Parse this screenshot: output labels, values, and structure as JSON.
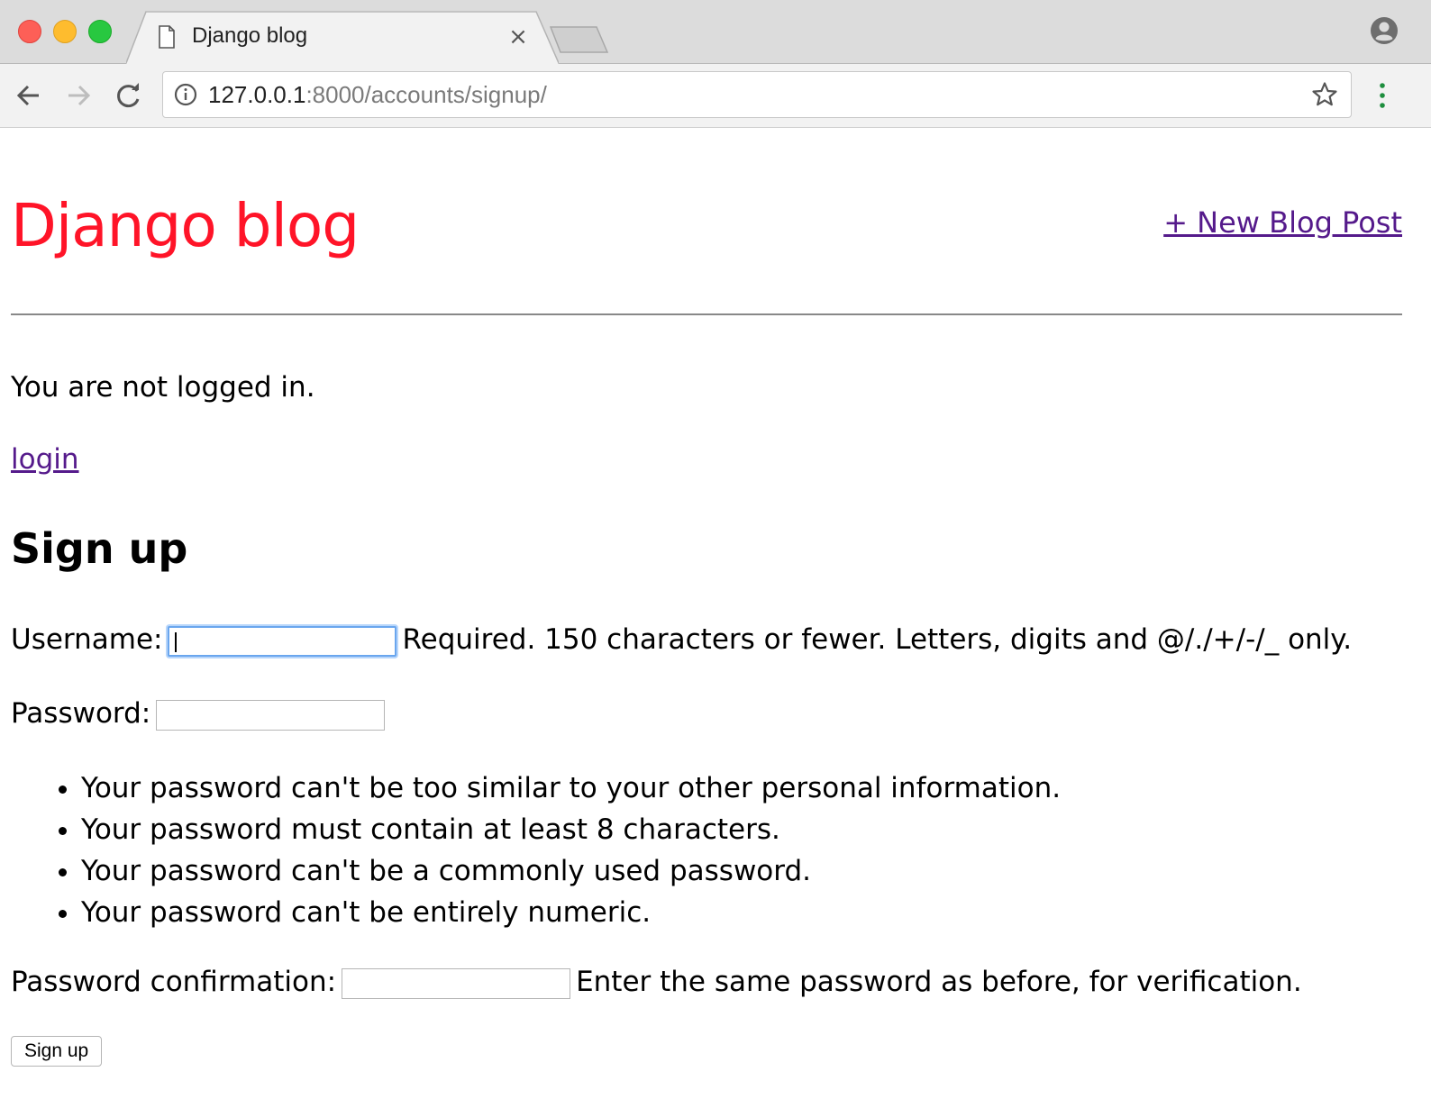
{
  "browser": {
    "tab_title": "Django blog",
    "tab_close": "×",
    "url_host": "127.0.0.1",
    "url_rest": ":8000/accounts/signup/"
  },
  "page": {
    "site_title": "Django blog",
    "new_post_link": "+ New Blog Post",
    "status_text": "You are not logged in.",
    "login_link": "login",
    "form_heading": "Sign up",
    "username_label": "Username:",
    "username_help": "Required. 150 characters or fewer. Letters, digits and @/./+/-/_ only.",
    "password_label": "Password:",
    "password_rules": [
      "Your password can't be too similar to your other personal information.",
      "Your password must contain at least 8 characters.",
      "Your password can't be a commonly used password.",
      "Your password can't be entirely numeric."
    ],
    "confirm_label": "Password confirmation:",
    "confirm_help": "Enter the same password as before, for verification.",
    "submit_label": "Sign up"
  },
  "colors": {
    "site_title": "#ff1428",
    "link": "#551a8b",
    "focus_ring": "#6aa6ee"
  },
  "icons": [
    "close-window-light",
    "minimize-window-light",
    "zoom-window-light",
    "page-icon",
    "close-icon",
    "profile-icon",
    "back-arrow-icon",
    "forward-arrow-icon",
    "reload-icon",
    "info-icon",
    "star-icon",
    "menu-dots-icon"
  ]
}
